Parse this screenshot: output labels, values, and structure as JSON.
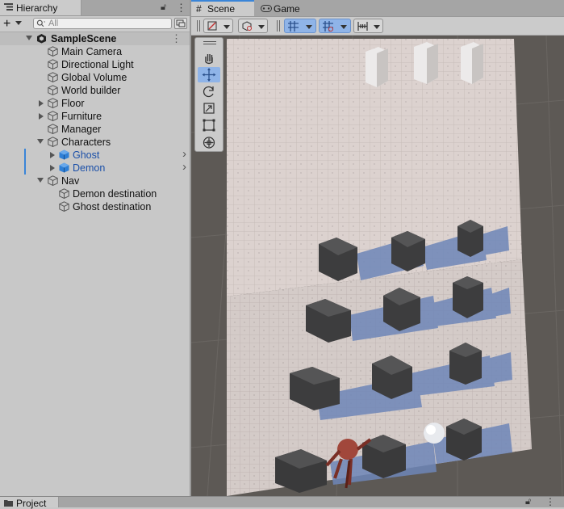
{
  "hierarchy": {
    "tab_label": "Hierarchy",
    "search_placeholder": "All",
    "scene_name": "SampleScene",
    "items": [
      {
        "label": "Main Camera",
        "indent": 1,
        "fold": "none",
        "selected": false
      },
      {
        "label": "Directional Light",
        "indent": 1,
        "fold": "none",
        "selected": false
      },
      {
        "label": "Global Volume",
        "indent": 1,
        "fold": "none",
        "selected": false
      },
      {
        "label": "World builder",
        "indent": 1,
        "fold": "none",
        "selected": false
      },
      {
        "label": "Floor",
        "indent": 1,
        "fold": "closed",
        "selected": false
      },
      {
        "label": "Furniture",
        "indent": 1,
        "fold": "closed",
        "selected": false
      },
      {
        "label": "Manager",
        "indent": 1,
        "fold": "none",
        "selected": false
      },
      {
        "label": "Characters",
        "indent": 1,
        "fold": "open",
        "selected": false
      },
      {
        "label": "Ghost",
        "indent": 2,
        "fold": "closed",
        "selected": true,
        "prefab": true
      },
      {
        "label": "Demon",
        "indent": 2,
        "fold": "closed",
        "selected": true,
        "prefab": true
      },
      {
        "label": "Nav",
        "indent": 1,
        "fold": "open",
        "selected": false
      },
      {
        "label": "Demon destination",
        "indent": 2,
        "fold": "none",
        "selected": false
      },
      {
        "label": "Ghost destination",
        "indent": 2,
        "fold": "none",
        "selected": false
      }
    ]
  },
  "scene_view": {
    "tabs": [
      {
        "label": "Scene",
        "icon": "grid-icon",
        "active": true
      },
      {
        "label": "Game",
        "icon": "gamepad-icon",
        "active": false
      }
    ],
    "toolbar": [
      "draw-mode-icon",
      "shading-mode-icon",
      "grid-snap-icon",
      "increment-snap-icon",
      "ruler-icon"
    ],
    "tools": [
      "hand-tool-icon",
      "move-tool-icon",
      "rotate-tool-icon",
      "scale-tool-icon",
      "rect-tool-icon",
      "transform-tool-icon"
    ],
    "active_tool": "move-tool-icon"
  },
  "project": {
    "tab_label": "Project"
  },
  "colors": {
    "selection": "#3a85d8",
    "prefab_text": "#1a4fa8",
    "active_button": "#8fb4e8"
  }
}
